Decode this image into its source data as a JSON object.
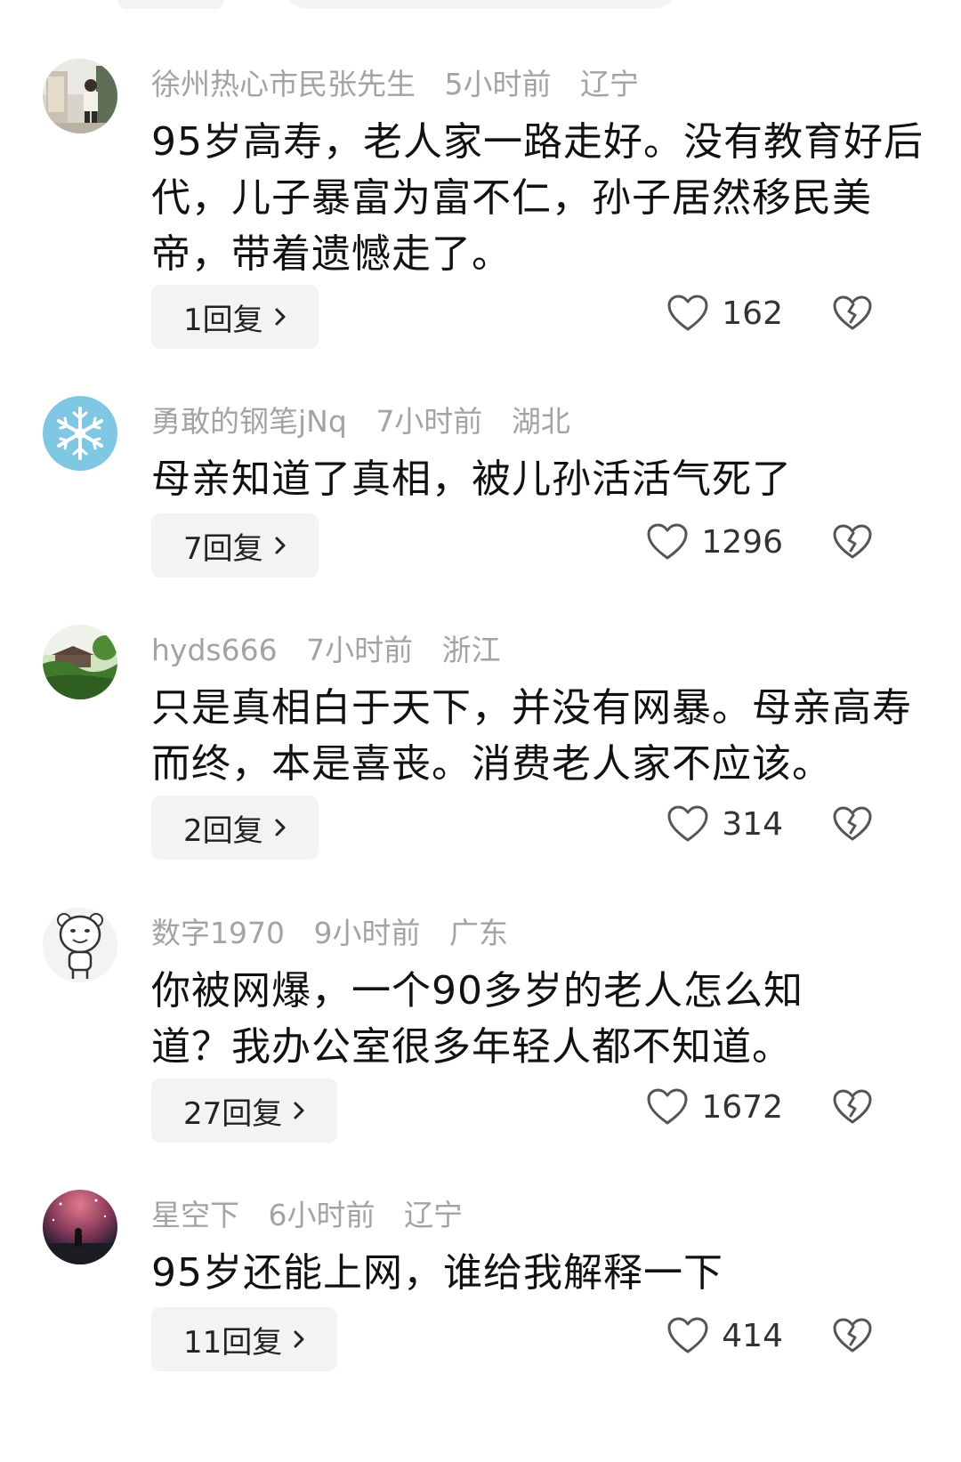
{
  "comments": [
    {
      "username": "徐州热心市民张先生",
      "time": "5小时前",
      "location": "辽宁",
      "text": "95岁高寿，老人家一路走好。没有教育好后代，儿子暴富为富不仁，孙子居然移民美帝，带着遗憾走了。",
      "reply_label": "1回复",
      "likes": "162",
      "avatar_icon": "photo-avatar-person"
    },
    {
      "username": "勇敢的钢笔jNq",
      "time": "7小时前",
      "location": "湖北",
      "text": "母亲知道了真相，被儿孙活活气死了",
      "reply_label": "7回复",
      "likes": "1296",
      "avatar_icon": "snowflake-avatar"
    },
    {
      "username": "hyds666",
      "time": "7小时前",
      "location": "浙江",
      "text": "只是真相白于天下，并没有网暴。母亲高寿而终，本是喜丧。消费老人家不应该。",
      "reply_label": "2回复",
      "likes": "314",
      "avatar_icon": "landscape-avatar"
    },
    {
      "username": "数字1970",
      "time": "9小时前",
      "location": "广东",
      "text": "你被网爆，一个90多岁的老人怎么知道？我办公室很多年轻人都不知道。",
      "reply_label": "27回复",
      "likes": "1672",
      "avatar_icon": "cartoon-bear-avatar"
    },
    {
      "username": "星空下",
      "time": "6小时前",
      "location": "辽宁",
      "text": "95岁还能上网，谁给我解释一下",
      "reply_label": "11回复",
      "likes": "414",
      "avatar_icon": "starry-sky-avatar"
    }
  ],
  "icons": {
    "like": "heart-outline-icon",
    "dislike": "broken-heart-icon",
    "chevron": "chevron-right-icon"
  }
}
